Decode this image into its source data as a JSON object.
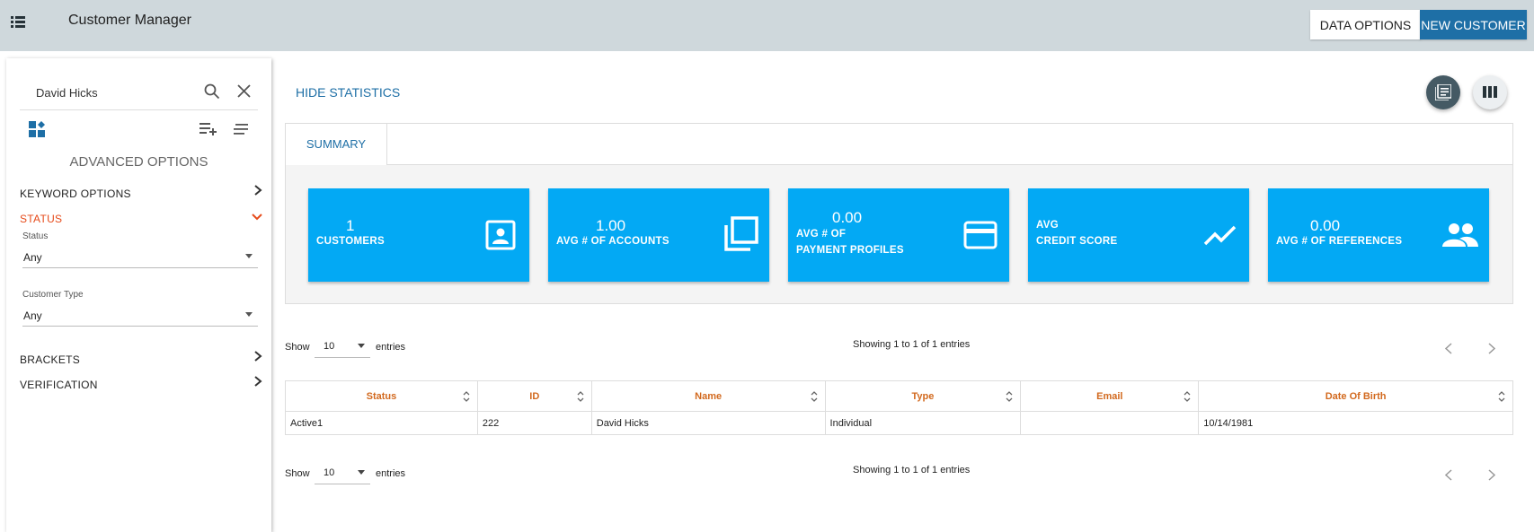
{
  "app": {
    "title": "Customer Manager"
  },
  "header": {
    "data_options_label": "DATA OPTIONS",
    "new_customer_label": "NEW CUSTOMER"
  },
  "sidebar": {
    "search": {
      "value": "David Hicks",
      "placeholder": ""
    },
    "advanced_title": "ADVANCED OPTIONS",
    "sections": {
      "keyword": "KEYWORD OPTIONS",
      "status": "STATUS",
      "brackets": "BRACKETS",
      "verification": "VERIFICATION"
    },
    "status_field": {
      "label": "Status",
      "value": "Any"
    },
    "customer_type_field": {
      "label": "Customer Type",
      "value": "Any"
    }
  },
  "main": {
    "hide_statistics_label": "HIDE STATISTICS",
    "summary_tab": "SUMMARY",
    "cards": [
      {
        "value": "1",
        "label_line1": "CUSTOMERS",
        "label_line2": "",
        "icon": "contact-card-icon"
      },
      {
        "value": "1.00",
        "label_line1": "AVG # OF ACCOUNTS",
        "label_line2": "",
        "icon": "copy-squares-icon"
      },
      {
        "value": "0.00",
        "label_line1": "AVG # OF",
        "label_line2": "PAYMENT PROFILES",
        "icon": "credit-card-icon"
      },
      {
        "value": "",
        "label_line1": "AVG",
        "label_line2": "CREDIT SCORE",
        "icon": "trending-line-icon"
      },
      {
        "value": "0.00",
        "label_line1": "AVG # OF REFERENCES",
        "label_line2": "",
        "icon": "people-icon"
      }
    ],
    "table_controls": {
      "show_label": "Show",
      "entries_label": "entries",
      "length_value": "10",
      "info_text": "Showing 1 to 1 of 1 entries"
    },
    "table": {
      "columns": [
        "Status",
        "ID",
        "Name",
        "Type",
        "Email",
        "Date Of Birth"
      ],
      "rows": [
        [
          "Active1",
          "222",
          "David Hicks",
          "Individual",
          "",
          "10/14/1981"
        ]
      ]
    }
  },
  "colors": {
    "accent": "#1e6fa6",
    "card": "#03a9f4",
    "status_red": "#e64a19",
    "header_orange": "#d2691e",
    "topbar": "#cfd8dc"
  }
}
